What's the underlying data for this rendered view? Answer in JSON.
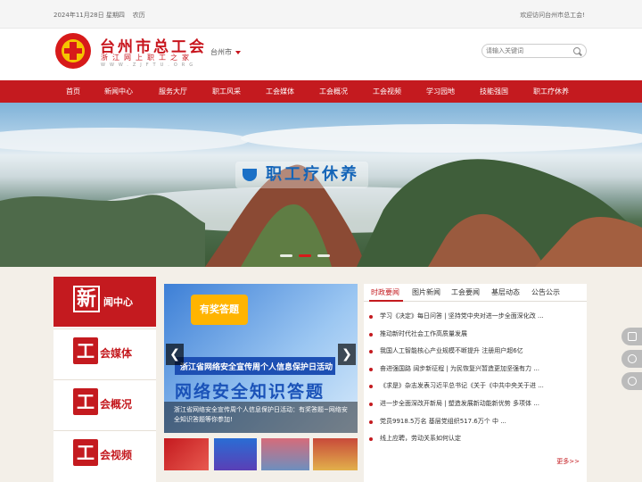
{
  "topbar": {
    "date": "2024年11月28日 星期四",
    "lunar": "农历",
    "welcome": "欢迎访问台州市总工会!"
  },
  "header": {
    "title": "台州市总工会",
    "subtitle": "浙江网上职工之家",
    "url": "WWW.ZJFTU.ORG",
    "region": "台州市",
    "search_placeholder": "请输入关键词"
  },
  "nav": {
    "items": [
      "首页",
      "新闻中心",
      "服务大厅",
      "职工风采",
      "工会媒体",
      "工会概况",
      "工会视频",
      "学习园地",
      "技能强国",
      "职工疗休养"
    ]
  },
  "banner": {
    "slogan": "职工疗休养"
  },
  "leftcol": {
    "tabs": [
      {
        "big": "新",
        "rest": "闻中心"
      },
      {
        "big": "工",
        "rest": "会媒体"
      },
      {
        "big": "工",
        "rest": "会概况"
      },
      {
        "big": "工",
        "rest": "会视频"
      }
    ]
  },
  "slider": {
    "badge": "有奖答题",
    "stripe_text": "浙江省网络安全宣传周个人信息保护日活动",
    "big_title": "网络安全知识答题",
    "caption": "浙江省网络安全宣传周个人信息保护日活动：有奖答题~网络安全知识答题等你参加!",
    "prev": "❮",
    "next": "❯"
  },
  "rightcol": {
    "tabs": [
      "时政要闻",
      "图片新闻",
      "工会要闻",
      "基层动态",
      "公告公示"
    ],
    "news": [
      "学习《决定》每日问答 | 坚持党中央对进一步全面深化改 ...",
      "推动新时代社会工作高质量发展",
      "我国人工智能核心产业规模不断提升 注册用户超6亿",
      "奋进强国路 阔步新征程 | 为民恢复兴暂造更加坚强有力 ...",
      "《求是》杂志发表习近平总书记《关于《中共中央关于进 ...",
      "进一步全面深改开新局 | 塑造发展新动能新优势 多项体 ...",
      "党员9918.5万名 基层党组织517.6万个 中 ...",
      "线上应聘，劳动关系如何认定"
    ],
    "more": "更多>>"
  },
  "colors": {
    "brand_red": "#c41a1f",
    "gold": "#f5c400",
    "page_bg": "#f3efe8"
  },
  "icons": [
    "search-icon",
    "chevron-down-icon",
    "chevron-left-icon",
    "chevron-right-icon",
    "video-icon",
    "share-icon",
    "globe-icon"
  ]
}
